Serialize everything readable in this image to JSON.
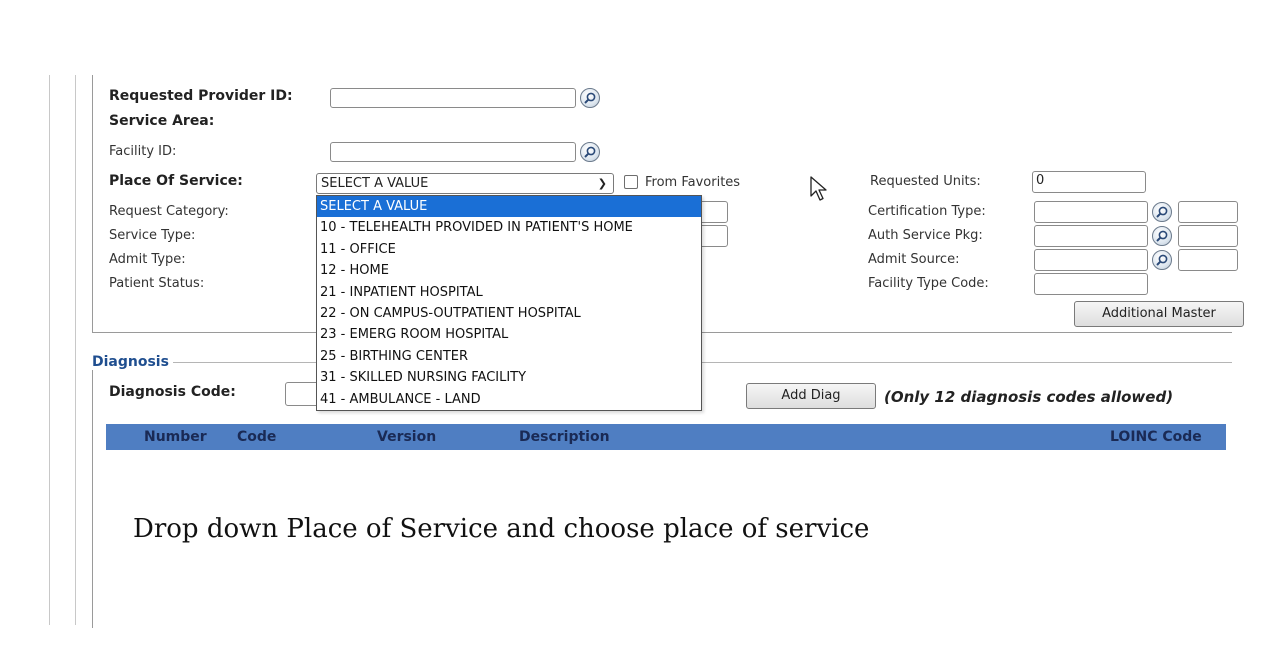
{
  "provider": {
    "requested_provider_id_label": "Requested Provider ID:",
    "service_area_label": "Service Area:",
    "facility_id_label": "Facility ID:",
    "requested_provider_id_value": "",
    "facility_id_value": ""
  },
  "place_of_service": {
    "label": "Place Of Service:",
    "selected": "SELECT A VALUE",
    "from_favorites_label": "From Favorites",
    "options": [
      "SELECT A VALUE",
      "10 - TELEHEALTH PROVIDED IN PATIENT'S HOME",
      "11 - OFFICE",
      "12 - HOME",
      "21 - INPATIENT HOSPITAL",
      "22 - ON CAMPUS-OUTPATIENT HOSPITAL",
      "23 - EMERG ROOM HOSPITAL",
      "25 - BIRTHING CENTER",
      "31 - SKILLED NURSING FACILITY",
      "41 - AMBULANCE - LAND"
    ]
  },
  "left_labels": {
    "request_category": "Request Category:",
    "service_type": "Service Type:",
    "admit_type": "Admit Type:",
    "patient_status": "Patient Status:"
  },
  "right_fields": {
    "requested_units_label": "Requested Units:",
    "requested_units_value": "0",
    "certification_type_label": "Certification Type:",
    "auth_service_pkg_label": "Auth Service Pkg:",
    "admit_source_label": "Admit Source:",
    "facility_type_code_label": "Facility Type Code:",
    "additional_master_button": "Additional Master"
  },
  "diagnosis": {
    "legend": "Diagnosis",
    "code_label": "Diagnosis Code:",
    "add_diag_button": "Add Diag",
    "note": "(Only 12 diagnosis codes allowed)",
    "columns": [
      "Number",
      "Code",
      "Version",
      "Description",
      "LOINC Code"
    ]
  },
  "instruction": "Drop down Place of Service and choose place of service",
  "colors": {
    "table_header": "#4f7ec2",
    "selected_option": "#1a6fd6",
    "legend_text": "#1f4e8f"
  },
  "icons": [
    "magnifier-lookup-icon",
    "dropdown-arrow-icon",
    "mouse-pointer-icon"
  ]
}
